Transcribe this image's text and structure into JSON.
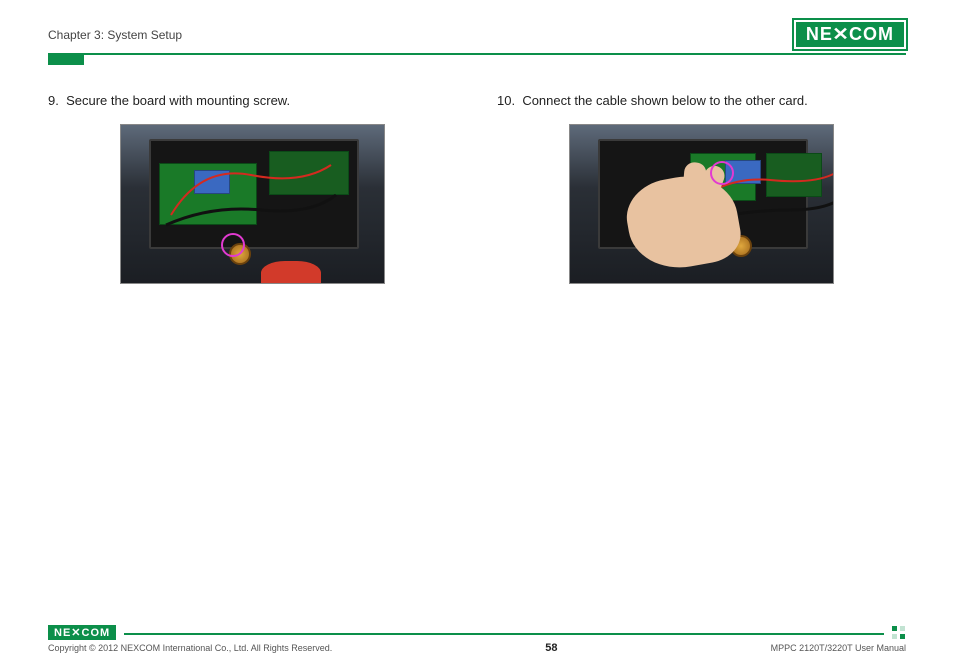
{
  "header": {
    "chapter": "Chapter 3: System Setup",
    "logo_text": "NE COM"
  },
  "steps": [
    {
      "number": "9.",
      "text": "Secure the board with mounting screw.",
      "image_alt": "Internal view of device showing circuit boards with a magenta circle marking a mounting screw location."
    },
    {
      "number": "10.",
      "text": "Connect the cable shown below to the other card.",
      "image_alt": "Hand connecting a cable to a card inside the device, magenta circle marks the connector."
    }
  ],
  "footer": {
    "logo_text": "NE COM",
    "copyright": "Copyright © 2012 NEXCOM International Co., Ltd. All Rights Reserved.",
    "page_number": "58",
    "manual": "MPPC 2120T/3220T User Manual"
  }
}
